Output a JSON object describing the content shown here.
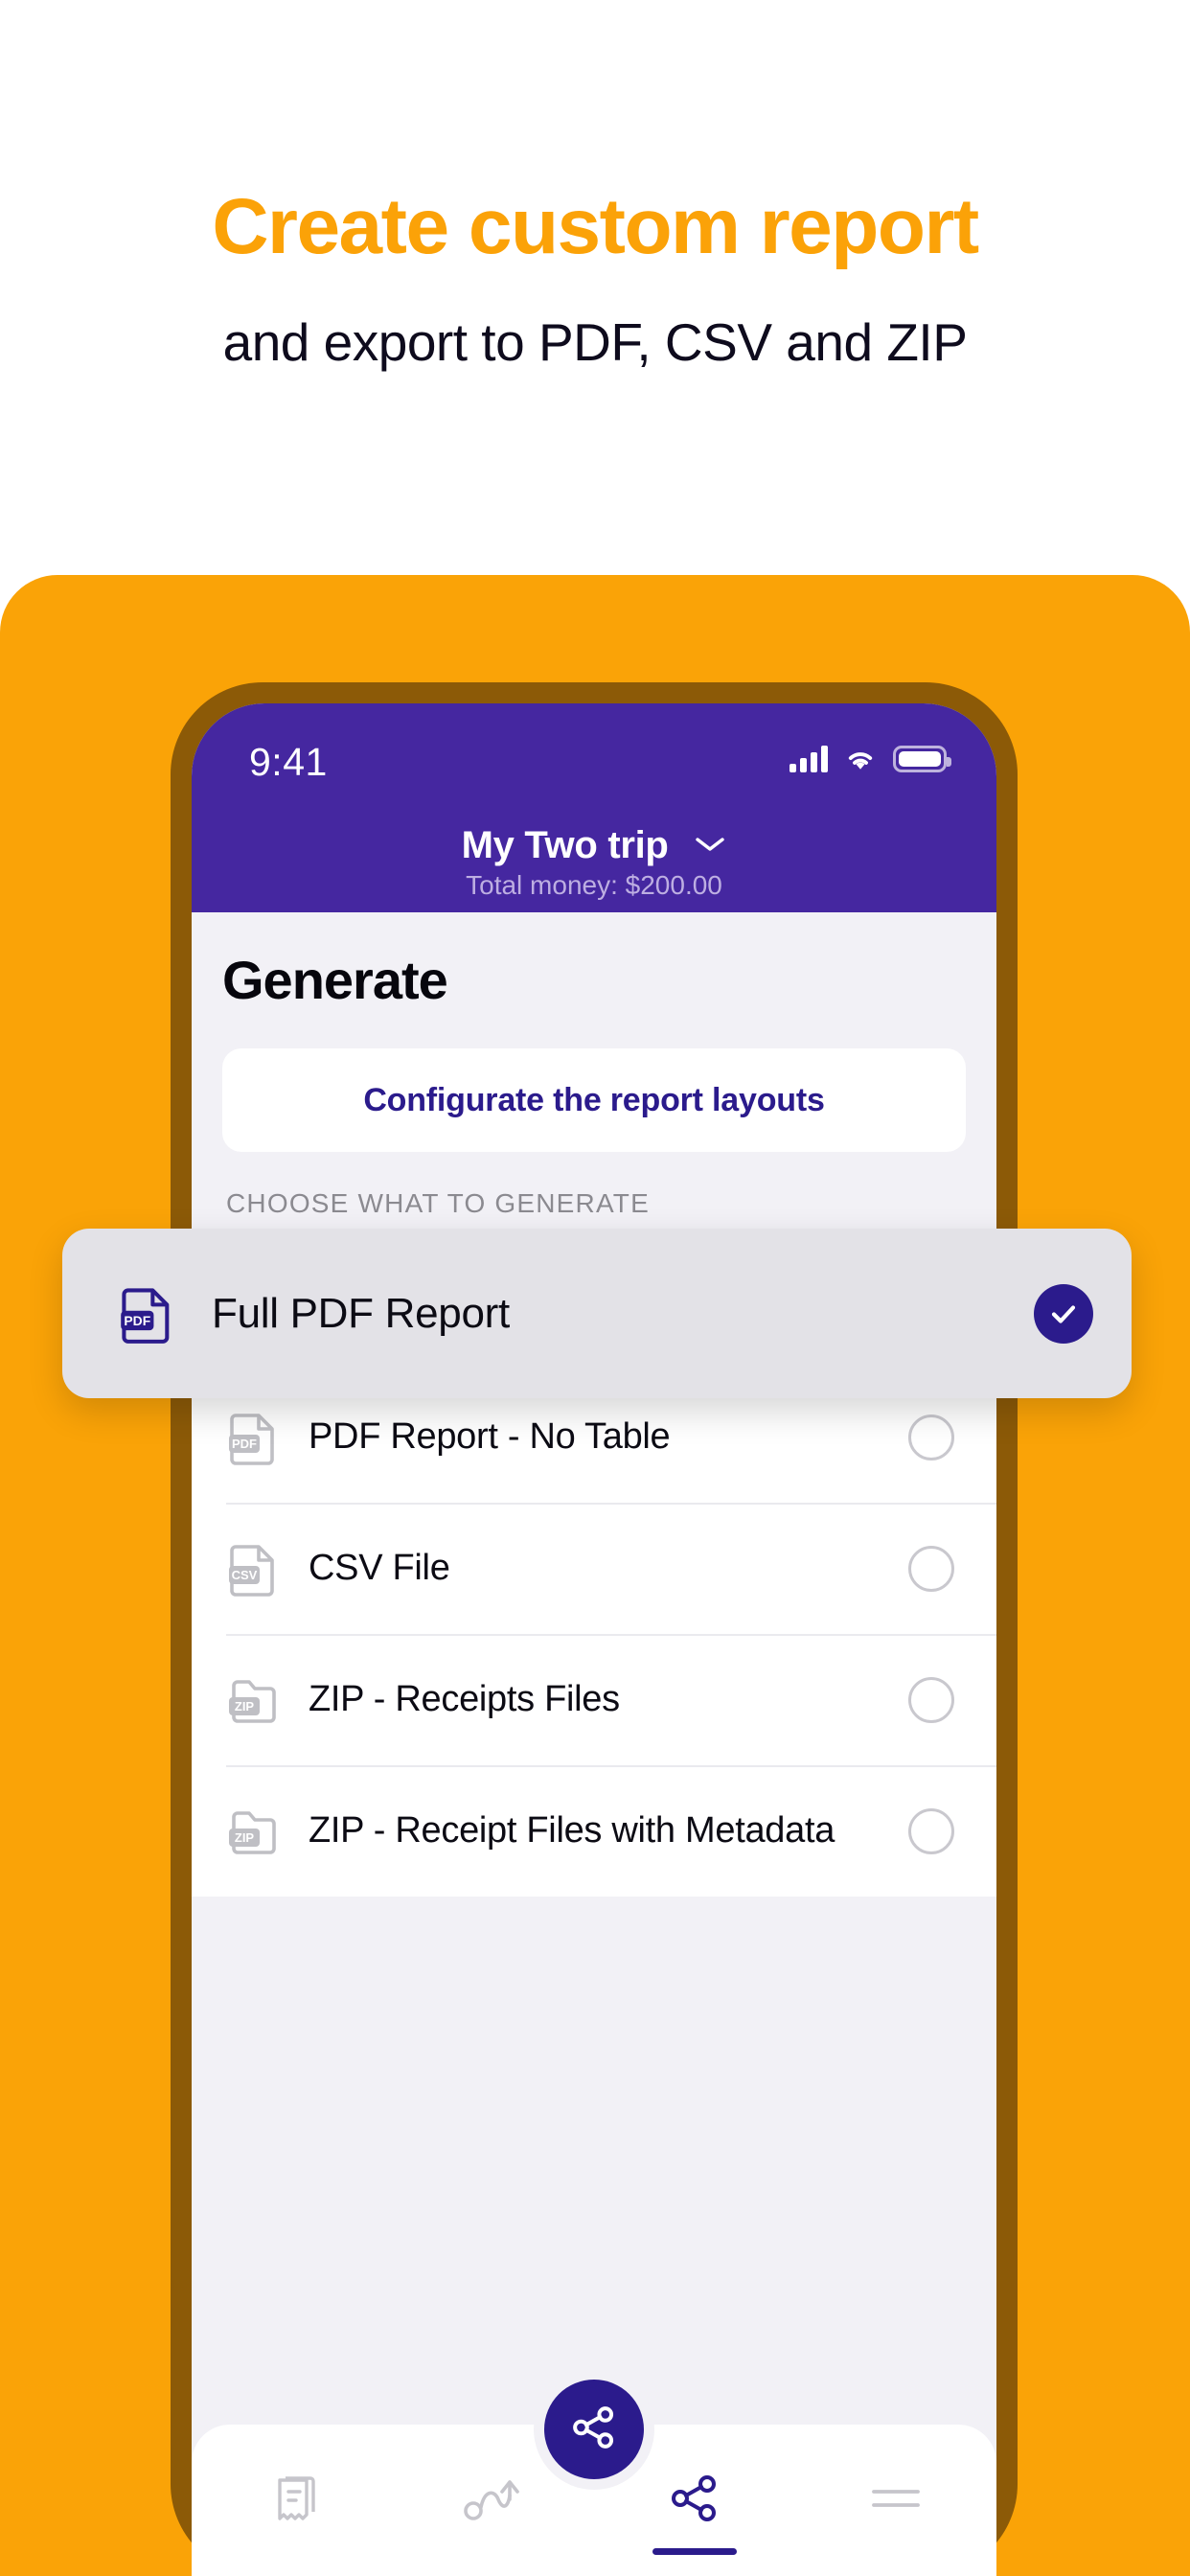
{
  "promo": {
    "title": "Create custom report",
    "subtitle": "and export to PDF, CSV and ZIP",
    "title_color": "#FBA208",
    "subtitle_color": "#0E0B1D",
    "panel_color": "#FAA307"
  },
  "status_bar": {
    "time": "9:41",
    "icons": [
      "cellular-signal-icon",
      "wifi-icon",
      "battery-icon"
    ],
    "background": "#4527A0"
  },
  "app_header": {
    "trip_title": "My  Two trip",
    "chevron": "chevron-down-icon",
    "total_money": "Total money: $200.00"
  },
  "main": {
    "page_title": "Generate",
    "config_button": "Configurate the report layouts",
    "config_button_color": "#2B1B8C",
    "section_label": "CHOOSE WHAT TO GENERATE",
    "options": [
      {
        "label": "Full PDF Report",
        "icon": "pdf-file-icon",
        "selected": true,
        "icon_color": "#2B1B8C"
      },
      {
        "label": "PDF Report - No Table",
        "icon": "pdf-file-icon",
        "selected": false,
        "icon_color": "#BFBFC4"
      },
      {
        "label": "CSV File",
        "icon": "csv-file-icon",
        "selected": false,
        "icon_color": "#BFBFC4"
      },
      {
        "label": "ZIP - Receipts Files",
        "icon": "zip-folder-icon",
        "selected": false,
        "icon_color": "#BFBFC4"
      },
      {
        "label": "ZIP - Receipt Files with Metadata",
        "icon": "zip-folder-icon",
        "selected": false,
        "icon_color": "#BFBFC4"
      }
    ],
    "icon_badges": {
      "pdf": "PDF",
      "csv": "CSV",
      "zip": "ZIP"
    }
  },
  "bottom_nav": {
    "items": [
      {
        "name": "receipts-tab",
        "icon": "receipt-icon",
        "active": false
      },
      {
        "name": "trips-tab",
        "icon": "route-arrow-icon",
        "active": false
      },
      {
        "name": "share-tab",
        "icon": "share-icon",
        "active": true
      },
      {
        "name": "menu-tab",
        "icon": "hamburger-menu-icon",
        "active": false
      }
    ],
    "fab": {
      "icon": "share-icon",
      "color": "#2B1B8C"
    }
  }
}
